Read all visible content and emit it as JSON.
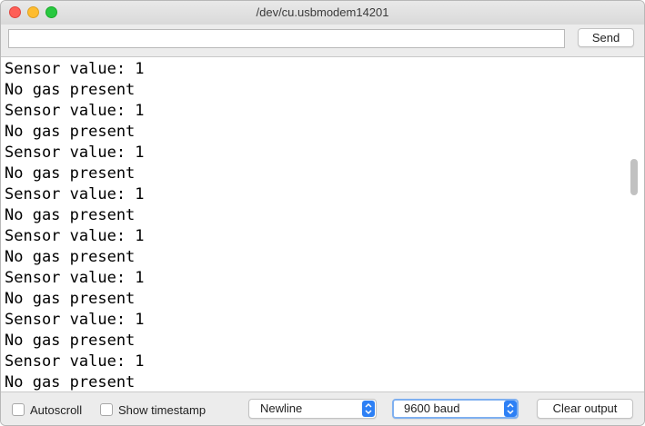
{
  "window": {
    "title": "/dev/cu.usbmodem14201"
  },
  "send_row": {
    "input_value": "",
    "input_placeholder": "",
    "send_label": "Send"
  },
  "output": {
    "lines": [
      "Sensor value: 1",
      "No gas present",
      "Sensor value: 1",
      "No gas present",
      "Sensor value: 1",
      "No gas present",
      "Sensor value: 1",
      "No gas present",
      "Sensor value: 1",
      "No gas present",
      "Sensor value: 1",
      "No gas present",
      "Sensor value: 1",
      "No gas present",
      "Sensor value: 1",
      "No gas present"
    ]
  },
  "bottom_bar": {
    "autoscroll_label": "Autoscroll",
    "autoscroll_checked": false,
    "timestamp_label": "Show timestamp",
    "timestamp_checked": false,
    "line_ending_selected": "Newline",
    "baud_selected": "9600 baud",
    "clear_label": "Clear output"
  },
  "colors": {
    "close": "#fe5f57",
    "minimize": "#febc2e",
    "maximize": "#28c840",
    "select_accent": "#2d80f5"
  }
}
